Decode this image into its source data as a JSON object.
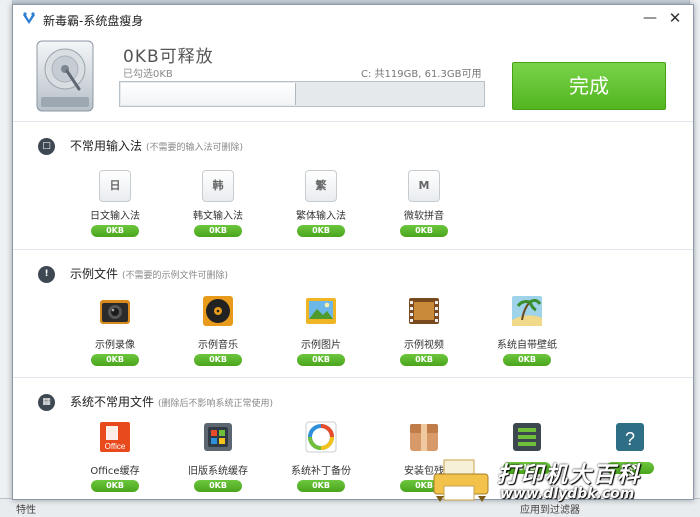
{
  "window": {
    "title": "新毒霸-系统盘瘦身"
  },
  "header": {
    "freed_text": "0KB可释放",
    "selected_text": "已勾选0KB",
    "disk_info": "C: 共119GB, 61.3GB可用",
    "progress_fraction": 0.48,
    "done_label": "完成"
  },
  "sections": [
    {
      "title": "不常用输入法",
      "hint": "(不需要的输入法可删除)",
      "icon_glyph": "□",
      "items": [
        {
          "key": "日",
          "label": "日文输入法",
          "size": "0KB"
        },
        {
          "key": "韩",
          "label": "韩文输入法",
          "size": "0KB"
        },
        {
          "key": "繁",
          "label": "繁体输入法",
          "size": "0KB"
        },
        {
          "key": "M",
          "label": "微软拼音",
          "size": "0KB"
        }
      ]
    },
    {
      "title": "示例文件",
      "hint": "(不需要的示例文件可删除)",
      "icon_glyph": "!",
      "items": [
        {
          "label": "示例录像",
          "size": "0KB"
        },
        {
          "label": "示例音乐",
          "size": "0KB"
        },
        {
          "label": "示例图片",
          "size": "0KB"
        },
        {
          "label": "示例视频",
          "size": "0KB"
        },
        {
          "label": "系统自带壁纸",
          "size": "0KB"
        }
      ]
    },
    {
      "title": "系统不常用文件",
      "hint": "(删除后不影响系统正常使用)",
      "icon_glyph": "▦",
      "items": [
        {
          "label": "Office缓存",
          "size": "0KB",
          "icon_text": "Office"
        },
        {
          "label": "旧版系统缓存",
          "size": "0KB"
        },
        {
          "label": "系统补丁备份",
          "size": "0KB"
        },
        {
          "label": "安装包残",
          "size": "0KB"
        },
        {
          "label": "",
          "size": "0KB"
        },
        {
          "label": "",
          "size": "0KB",
          "icon_text": "?"
        }
      ]
    }
  ],
  "background": {
    "left_text": "特性",
    "right_text": "应用到过滤器"
  },
  "watermark": {
    "text": "打印机大百科",
    "url": "www.dlydbk.com"
  },
  "colors": {
    "accent_green": "#52b51f",
    "badge_green": "#4aa51d"
  }
}
